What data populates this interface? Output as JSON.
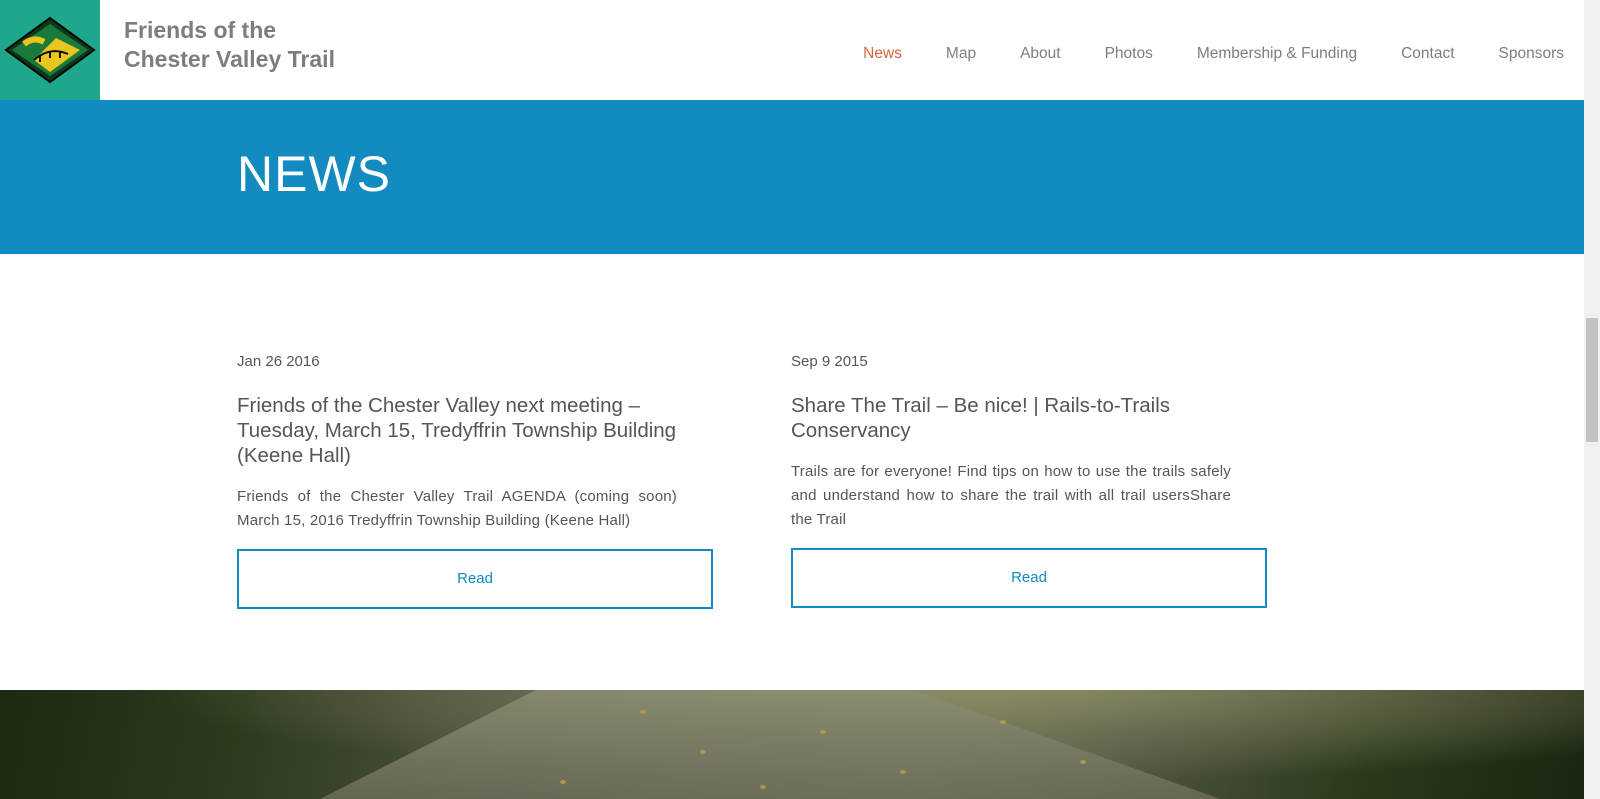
{
  "header": {
    "site_title_line1": "Friends of the",
    "site_title_line2": "Chester Valley Trail",
    "nav": [
      {
        "label": "News",
        "active": true
      },
      {
        "label": "Map",
        "active": false
      },
      {
        "label": "About",
        "active": false
      },
      {
        "label": "Photos",
        "active": false
      },
      {
        "label": "Membership & Funding",
        "active": false
      },
      {
        "label": "Contact",
        "active": false
      },
      {
        "label": "Sponsors",
        "active": false
      }
    ]
  },
  "hero": {
    "title": "NEWS"
  },
  "posts": [
    {
      "date": "Jan 26 2016",
      "title": "Friends of the Chester Valley next meeting – Tuesday, March 15, Tredyffrin Township Building (Keene Hall)",
      "excerpt": "Friends of the Chester Valley Trail AGENDA (coming soon) March 15, 2016 Tredyffrin Township Building (Keene Hall)",
      "button": "Read"
    },
    {
      "date": "Sep 9 2015",
      "title": "Share The Trail – Be nice! | Rails-to-Trails Conservancy",
      "excerpt": "Trails are for everyone! Find tips on how to use the trails safely and understand how to share the trail with all trail usersShare the Trail",
      "button": "Read"
    }
  ],
  "colors": {
    "brand_blue": "#138bc0",
    "logo_green": "#1ea78a",
    "nav_active": "#d8633d",
    "text_gray": "#7d7d7d"
  },
  "icons": {
    "logo": "trail-bridge-diamond-logo"
  }
}
